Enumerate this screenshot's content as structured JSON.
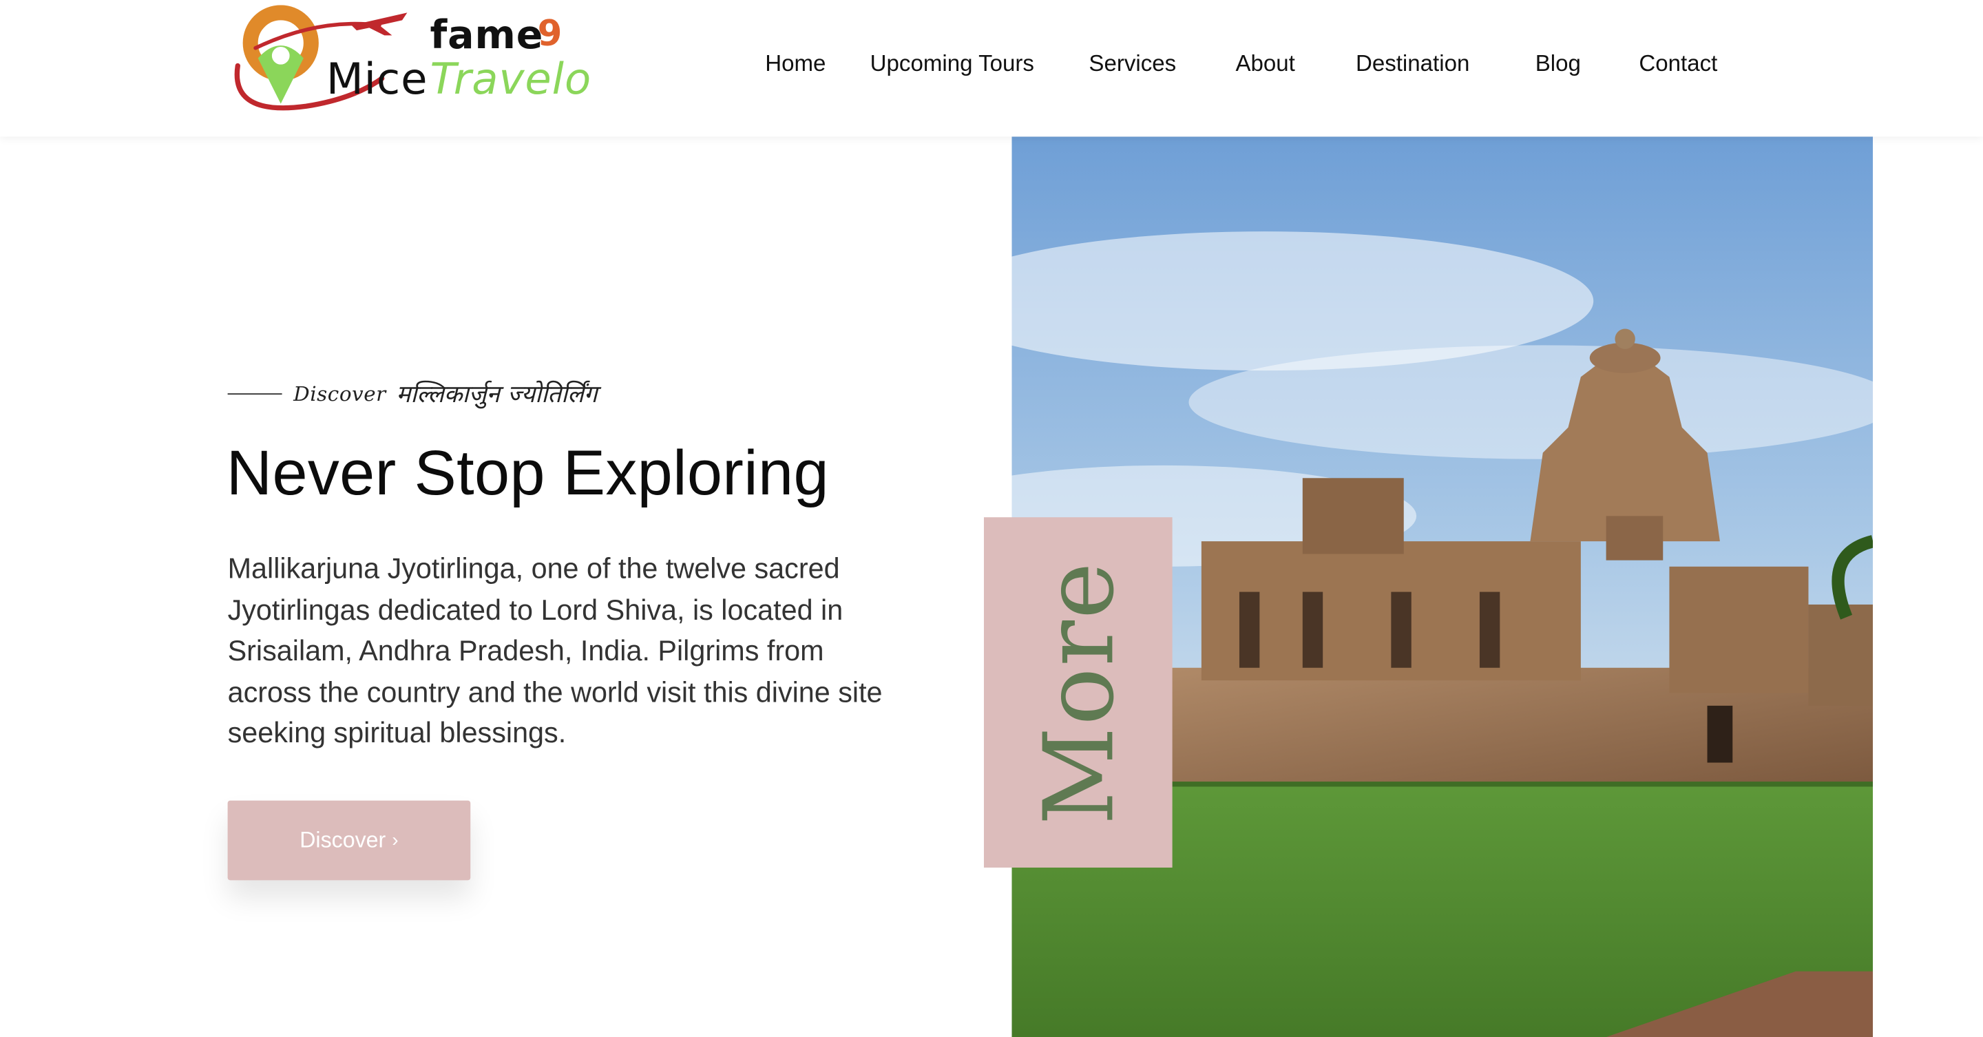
{
  "logo": {
    "word_top": "fame",
    "number": "9",
    "word_left": "Mice",
    "word_right": "Travelo",
    "icon": "map-pin-with-airplane-icon",
    "colors": {
      "pin": "#8bd65a",
      "ring": "#e08a2a",
      "swoosh": "#c0282d",
      "nine": "#e0622c",
      "travelo": "#8bd65a"
    }
  },
  "nav": {
    "items": [
      {
        "label": "Home"
      },
      {
        "label": "Upcoming Tours"
      },
      {
        "label": "Services"
      },
      {
        "label": "About"
      },
      {
        "label": "Destination"
      },
      {
        "label": "Blog"
      },
      {
        "label": "Contact"
      }
    ]
  },
  "hero": {
    "eyebrow_prefix": "Discover",
    "eyebrow_hindi": "मल्लिकार्जुन ज्योतिर्लिंग",
    "title": "Never Stop Exploring",
    "description": "Mallikarjuna Jyotirlinga, one of the twelve sacred Jyotirlingas dedicated to Lord Shiva, is located in Srisailam, Andhra Pradesh, India. Pilgrims from across the country and the world visit this divine site seeking spiritual blessings.",
    "button_label": "Discover",
    "button_icon": "chevron-right-icon",
    "more_label": "More",
    "accent_color": "#dcbcbb"
  }
}
